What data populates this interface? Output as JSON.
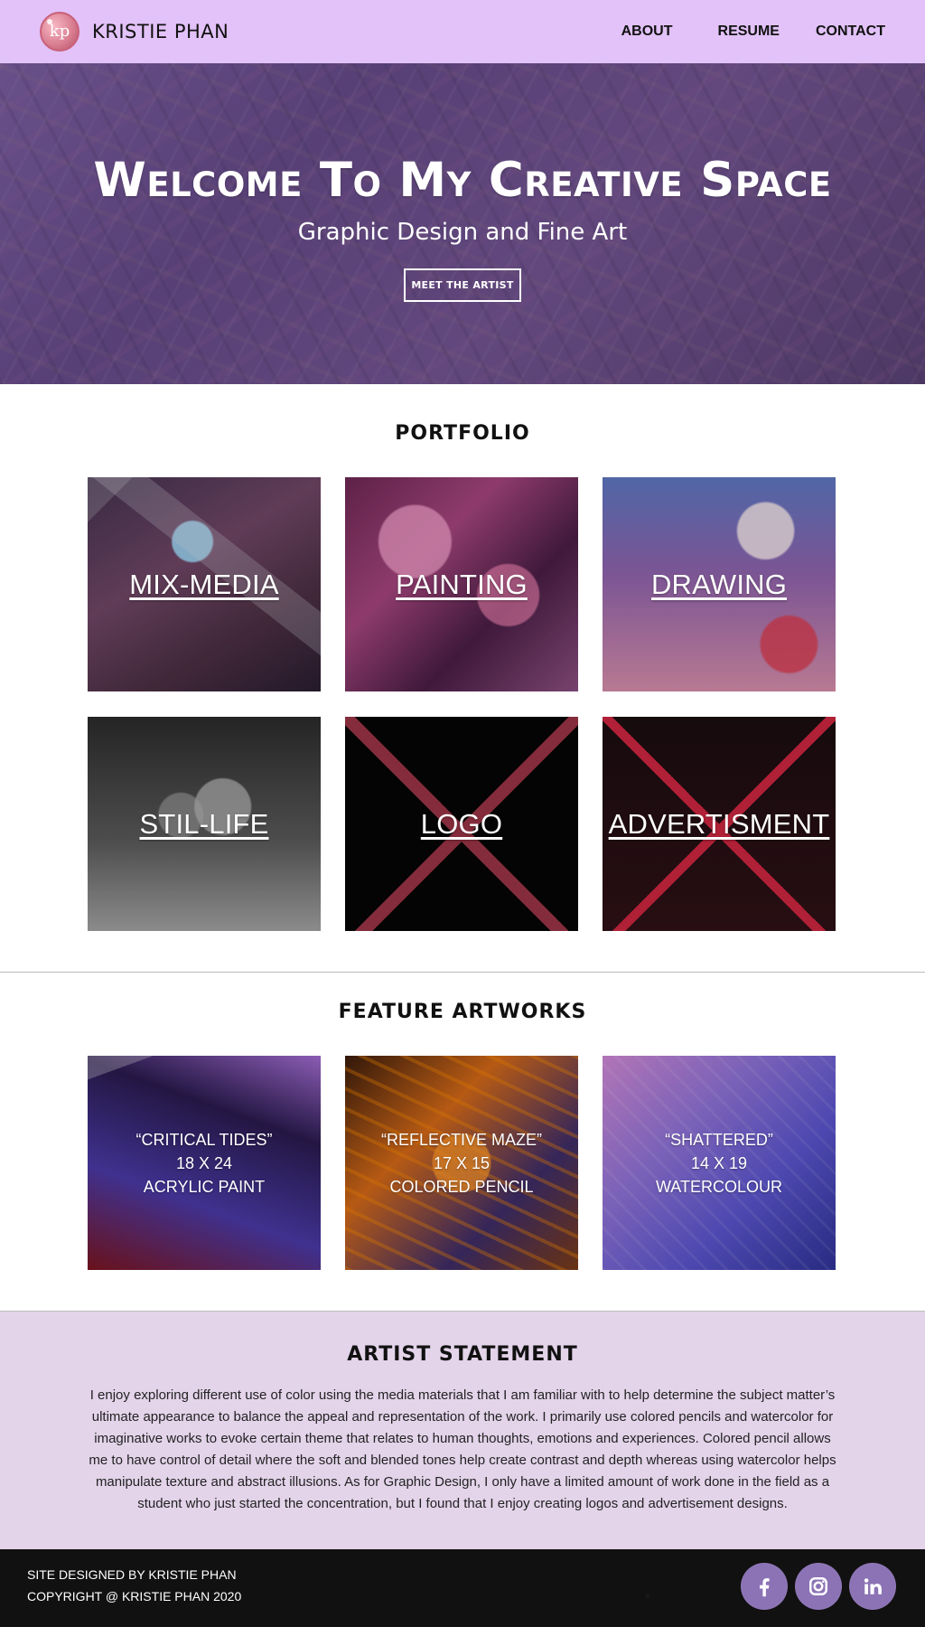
{
  "header": {
    "logo_text": "kp",
    "brand": "KRISTIE PHAN",
    "nav": [
      "ABOUT",
      "RESUME",
      "CONTACT"
    ]
  },
  "hero": {
    "title": "Welcome To My Creative Space",
    "subtitle": "Graphic Design and Fine Art",
    "button": "MEET THE ARTIST"
  },
  "portfolio": {
    "title": "PORTFOLIO",
    "items": [
      {
        "label": "MIX-MEDIA"
      },
      {
        "label": "PAINTING"
      },
      {
        "label": "DRAWING"
      },
      {
        "label": "STIL-LIFE"
      },
      {
        "label": "LOGO"
      },
      {
        "label": "ADVERTISMENT"
      }
    ]
  },
  "features": {
    "title": "FEATURE ARTWORKS",
    "items": [
      {
        "line1": "“CRITICAL TIDES”",
        "line2": "18 X 24",
        "line3": "ACRYLIC PAINT"
      },
      {
        "line1": "“REFLECTIVE MAZE”",
        "line2": "17 X 15",
        "line3": "COLORED PENCIL"
      },
      {
        "line1": "“SHATTERED”",
        "line2": "14 X 19",
        "line3": "WATERCOLOUR"
      }
    ]
  },
  "statement": {
    "title": "ARTIST STATEMENT",
    "body": "I enjoy exploring different use of color using the media materials that I am familiar with to help determine the subject matter’s ultimate appearance to balance the appeal and representation of the work. I primarily use colored pencils and watercolor for imaginative works to evoke certain theme that relates to human thoughts, emotions and experiences. Colored pencil allows me to have control of detail where the soft and blended tones help create contrast and depth whereas using watercolor helps manipulate texture and abstract illusions. As for Graphic Design, I only have a limited amount of work done in the field as a student who just started the concentration, but I found that I enjoy creating logos and advertisement designs."
  },
  "footer": {
    "line1": "SITE DESIGNED BY KRISTIE PHAN",
    "line2": "COPYRIGHT @ KRISTIE PHAN 2020",
    "social_icons": [
      "facebook-icon",
      "instagram-icon",
      "linkedin-icon"
    ]
  },
  "colors": {
    "nav_bg": "#e2c2f8",
    "statement_bg": "#e3d4ea",
    "footer_bg": "#111111",
    "social_bg": "#8c73b5"
  }
}
